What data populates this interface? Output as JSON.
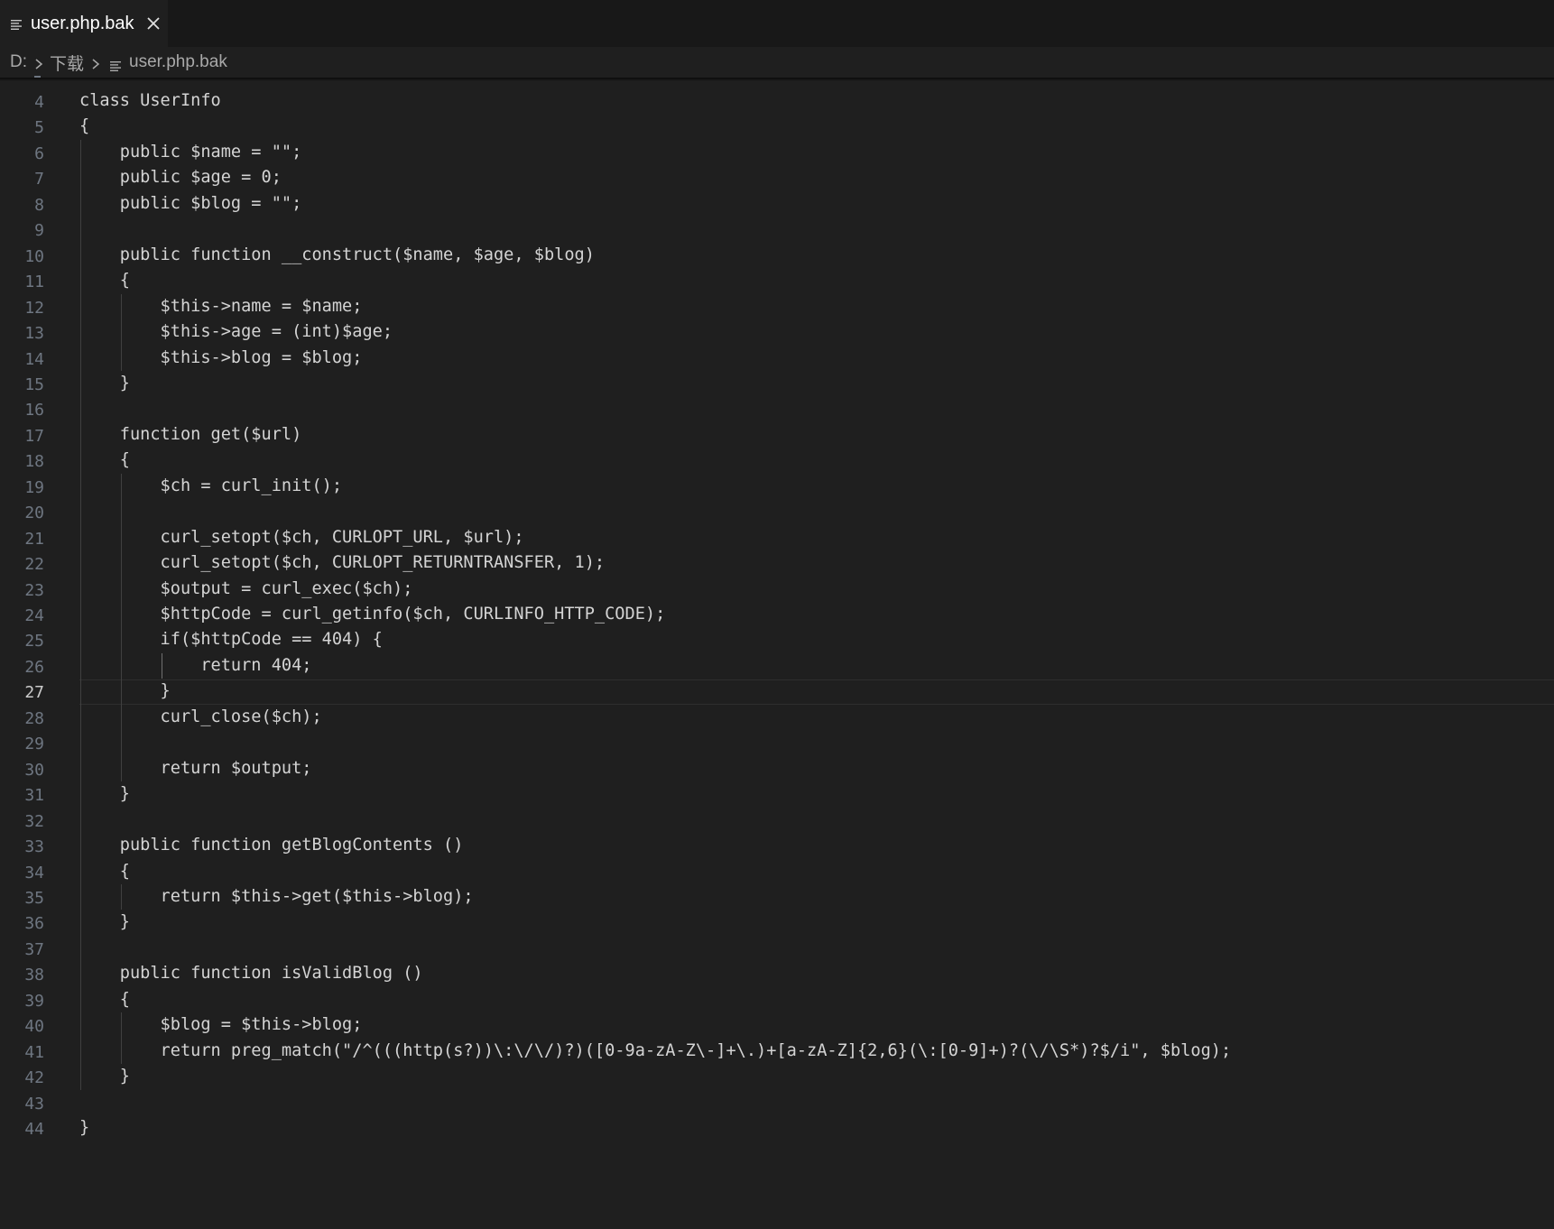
{
  "tab": {
    "icon": "file-lines-icon",
    "label": "user.php.bak",
    "close_icon": "close-icon"
  },
  "breadcrumb": {
    "items": [
      "D:",
      "下载",
      "user.php.bak"
    ]
  },
  "editor": {
    "active_line": 27,
    "lines": [
      {
        "n": "4",
        "text": "class UserInfo"
      },
      {
        "n": "5",
        "text": "{"
      },
      {
        "n": "6",
        "text": "    public $name = \"\";"
      },
      {
        "n": "7",
        "text": "    public $age = 0;"
      },
      {
        "n": "8",
        "text": "    public $blog = \"\";"
      },
      {
        "n": "9",
        "text": ""
      },
      {
        "n": "10",
        "text": "    public function __construct($name, $age, $blog)"
      },
      {
        "n": "11",
        "text": "    {"
      },
      {
        "n": "12",
        "text": "        $this->name = $name;"
      },
      {
        "n": "13",
        "text": "        $this->age = (int)$age;"
      },
      {
        "n": "14",
        "text": "        $this->blog = $blog;"
      },
      {
        "n": "15",
        "text": "    }"
      },
      {
        "n": "16",
        "text": ""
      },
      {
        "n": "17",
        "text": "    function get($url)"
      },
      {
        "n": "18",
        "text": "    {"
      },
      {
        "n": "19",
        "text": "        $ch = curl_init();"
      },
      {
        "n": "20",
        "text": ""
      },
      {
        "n": "21",
        "text": "        curl_setopt($ch, CURLOPT_URL, $url);"
      },
      {
        "n": "22",
        "text": "        curl_setopt($ch, CURLOPT_RETURNTRANSFER, 1);"
      },
      {
        "n": "23",
        "text": "        $output = curl_exec($ch);"
      },
      {
        "n": "24",
        "text": "        $httpCode = curl_getinfo($ch, CURLINFO_HTTP_CODE);"
      },
      {
        "n": "25",
        "text": "        if($httpCode == 404) {"
      },
      {
        "n": "26",
        "text": "            return 404;"
      },
      {
        "n": "27",
        "text": "        }"
      },
      {
        "n": "28",
        "text": "        curl_close($ch);"
      },
      {
        "n": "29",
        "text": ""
      },
      {
        "n": "30",
        "text": "        return $output;"
      },
      {
        "n": "31",
        "text": "    }"
      },
      {
        "n": "32",
        "text": ""
      },
      {
        "n": "33",
        "text": "    public function getBlogContents ()"
      },
      {
        "n": "34",
        "text": "    {"
      },
      {
        "n": "35",
        "text": "        return $this->get($this->blog);"
      },
      {
        "n": "36",
        "text": "    }"
      },
      {
        "n": "37",
        "text": ""
      },
      {
        "n": "38",
        "text": "    public function isValidBlog ()"
      },
      {
        "n": "39",
        "text": "    {"
      },
      {
        "n": "40",
        "text": "        $blog = $this->blog;"
      },
      {
        "n": "41",
        "text": "        return preg_match(\"/^(((http(s?))\\:\\/\\/)?)([0-9a-zA-Z\\-]+\\.)+[a-zA-Z]{2,6}(\\:[0-9]+)?(\\/\\S*)?$/i\", $blog);"
      },
      {
        "n": "42",
        "text": "    }"
      },
      {
        "n": "43",
        "text": ""
      },
      {
        "n": "44",
        "text": "}"
      }
    ]
  }
}
